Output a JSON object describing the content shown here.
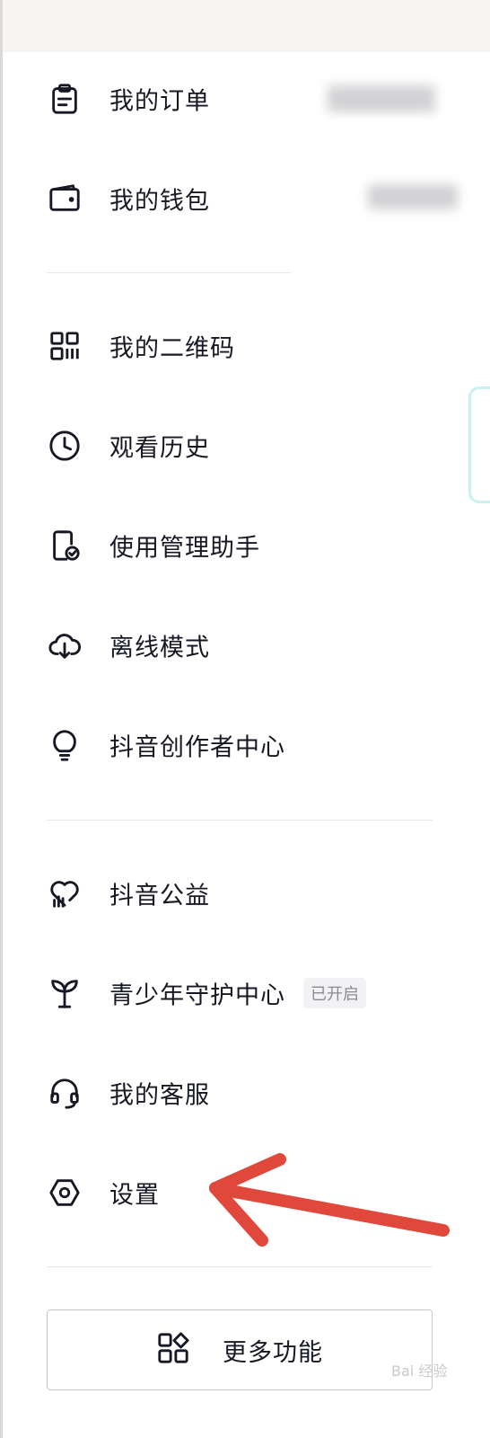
{
  "menu": {
    "orders": {
      "label": "我的订单",
      "icon": "clipboard-icon"
    },
    "wallet": {
      "label": "我的钱包",
      "icon": "wallet-icon"
    },
    "qrcode": {
      "label": "我的二维码",
      "icon": "qrcode-icon"
    },
    "history": {
      "label": "观看历史",
      "icon": "clock-icon"
    },
    "usage_manager": {
      "label": "使用管理助手",
      "icon": "phone-check-icon"
    },
    "offline": {
      "label": "离线模式",
      "icon": "cloud-download-icon"
    },
    "creator_center": {
      "label": "抖音创作者中心",
      "icon": "lightbulb-icon"
    },
    "charity": {
      "label": "抖音公益",
      "icon": "heart-pulse-icon"
    },
    "youth_mode": {
      "label": "青少年守护中心",
      "badge": "已开启",
      "icon": "sprout-icon"
    },
    "service": {
      "label": "我的客服",
      "icon": "headset-icon"
    },
    "settings": {
      "label": "设置",
      "icon": "hexagon-settings-icon"
    }
  },
  "more_button": {
    "label": "更多功能",
    "icon": "grid-shapes-icon"
  },
  "annotation": {
    "arrow_color": "#e0483c"
  },
  "watermark": {
    "text": "Bai 经验"
  }
}
